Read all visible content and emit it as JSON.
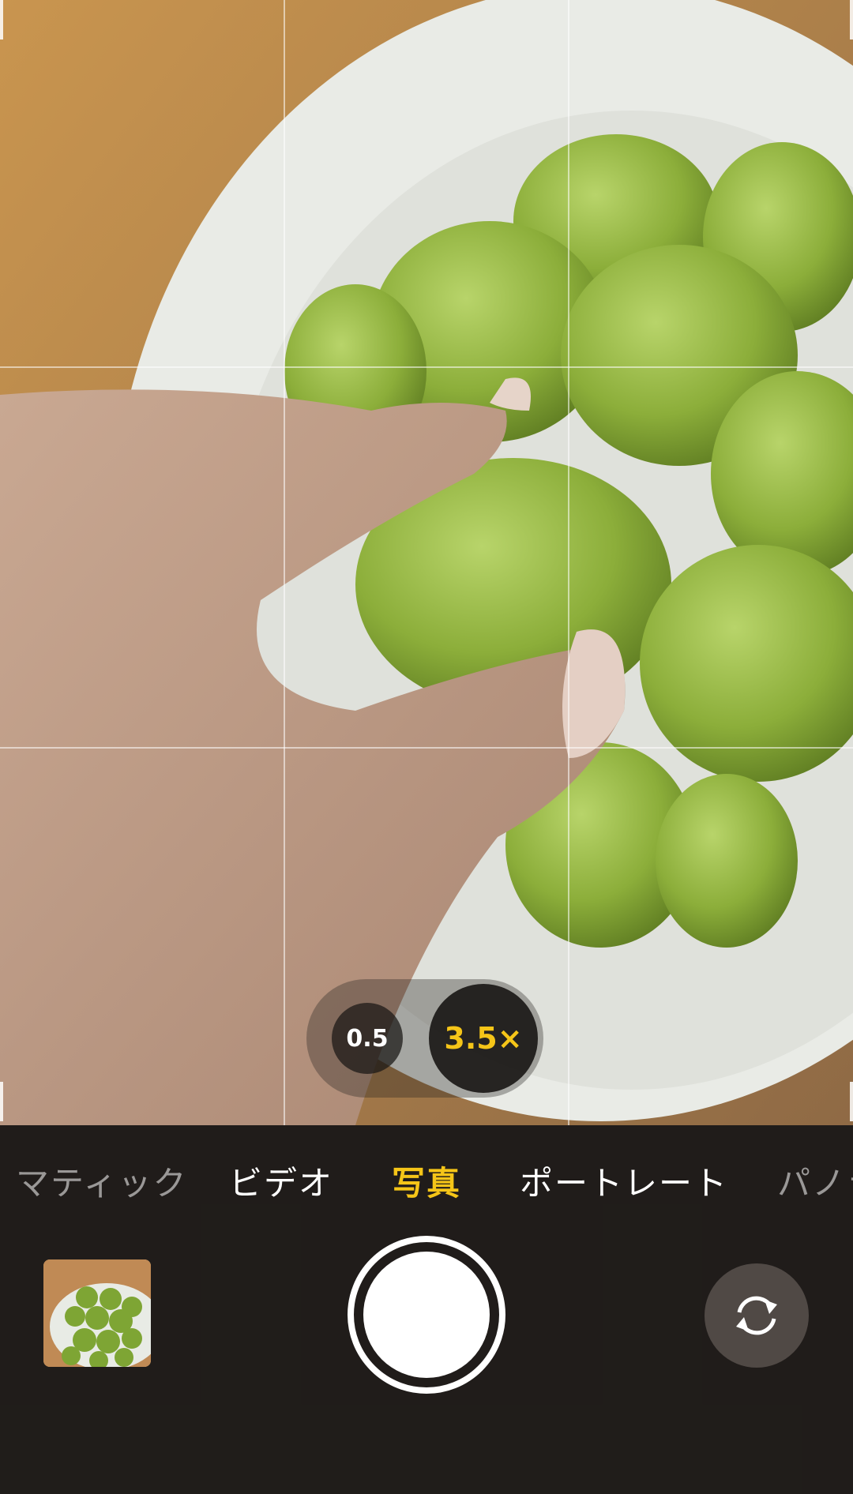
{
  "zoom": {
    "options": [
      "0.5",
      "3.5×"
    ],
    "active": "3.5×"
  },
  "modes": {
    "items": [
      "マティック",
      "ビデオ",
      "写真",
      "ポートレート",
      "パノラ"
    ],
    "active": "写真"
  },
  "colors": {
    "accent": "#f5c518"
  },
  "icons": {
    "thumbnail": "last-photo-thumbnail",
    "shutter": "shutter-button",
    "flip": "camera-flip-icon"
  }
}
